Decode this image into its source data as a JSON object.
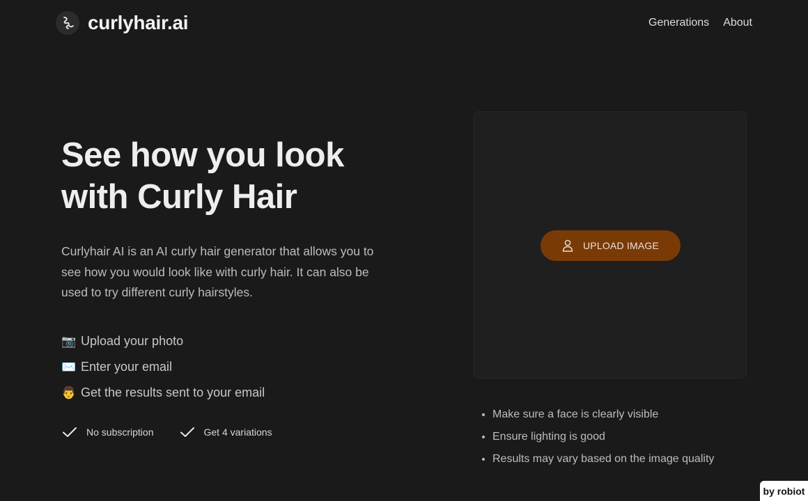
{
  "header": {
    "brand": "curlyhair.ai",
    "nav": [
      "Generations",
      "About"
    ]
  },
  "hero": {
    "title_line1": "See how you look",
    "title_line2": "with Curly Hair",
    "description": "Curlyhair AI is an AI curly hair generator that allows you to see how you would look like with curly hair. It can also be used to try different curly hairstyles."
  },
  "steps": [
    {
      "emoji": "📷",
      "text": "Upload your photo"
    },
    {
      "emoji": "✉️",
      "text": "Enter your email"
    },
    {
      "emoji": "👨",
      "text": "Get the results sent to your email"
    }
  ],
  "features": [
    "No subscription",
    "Get 4 variations"
  ],
  "upload": {
    "button_label": "UPLOAD IMAGE"
  },
  "tips": [
    "Make sure a face is clearly visible",
    "Ensure lighting is good",
    "Results may vary based on the image quality"
  ],
  "credit": "by robiot",
  "colors": {
    "background": "#1a1a1a",
    "panel": "#1f1f1f",
    "accent": "#7a3a06"
  }
}
